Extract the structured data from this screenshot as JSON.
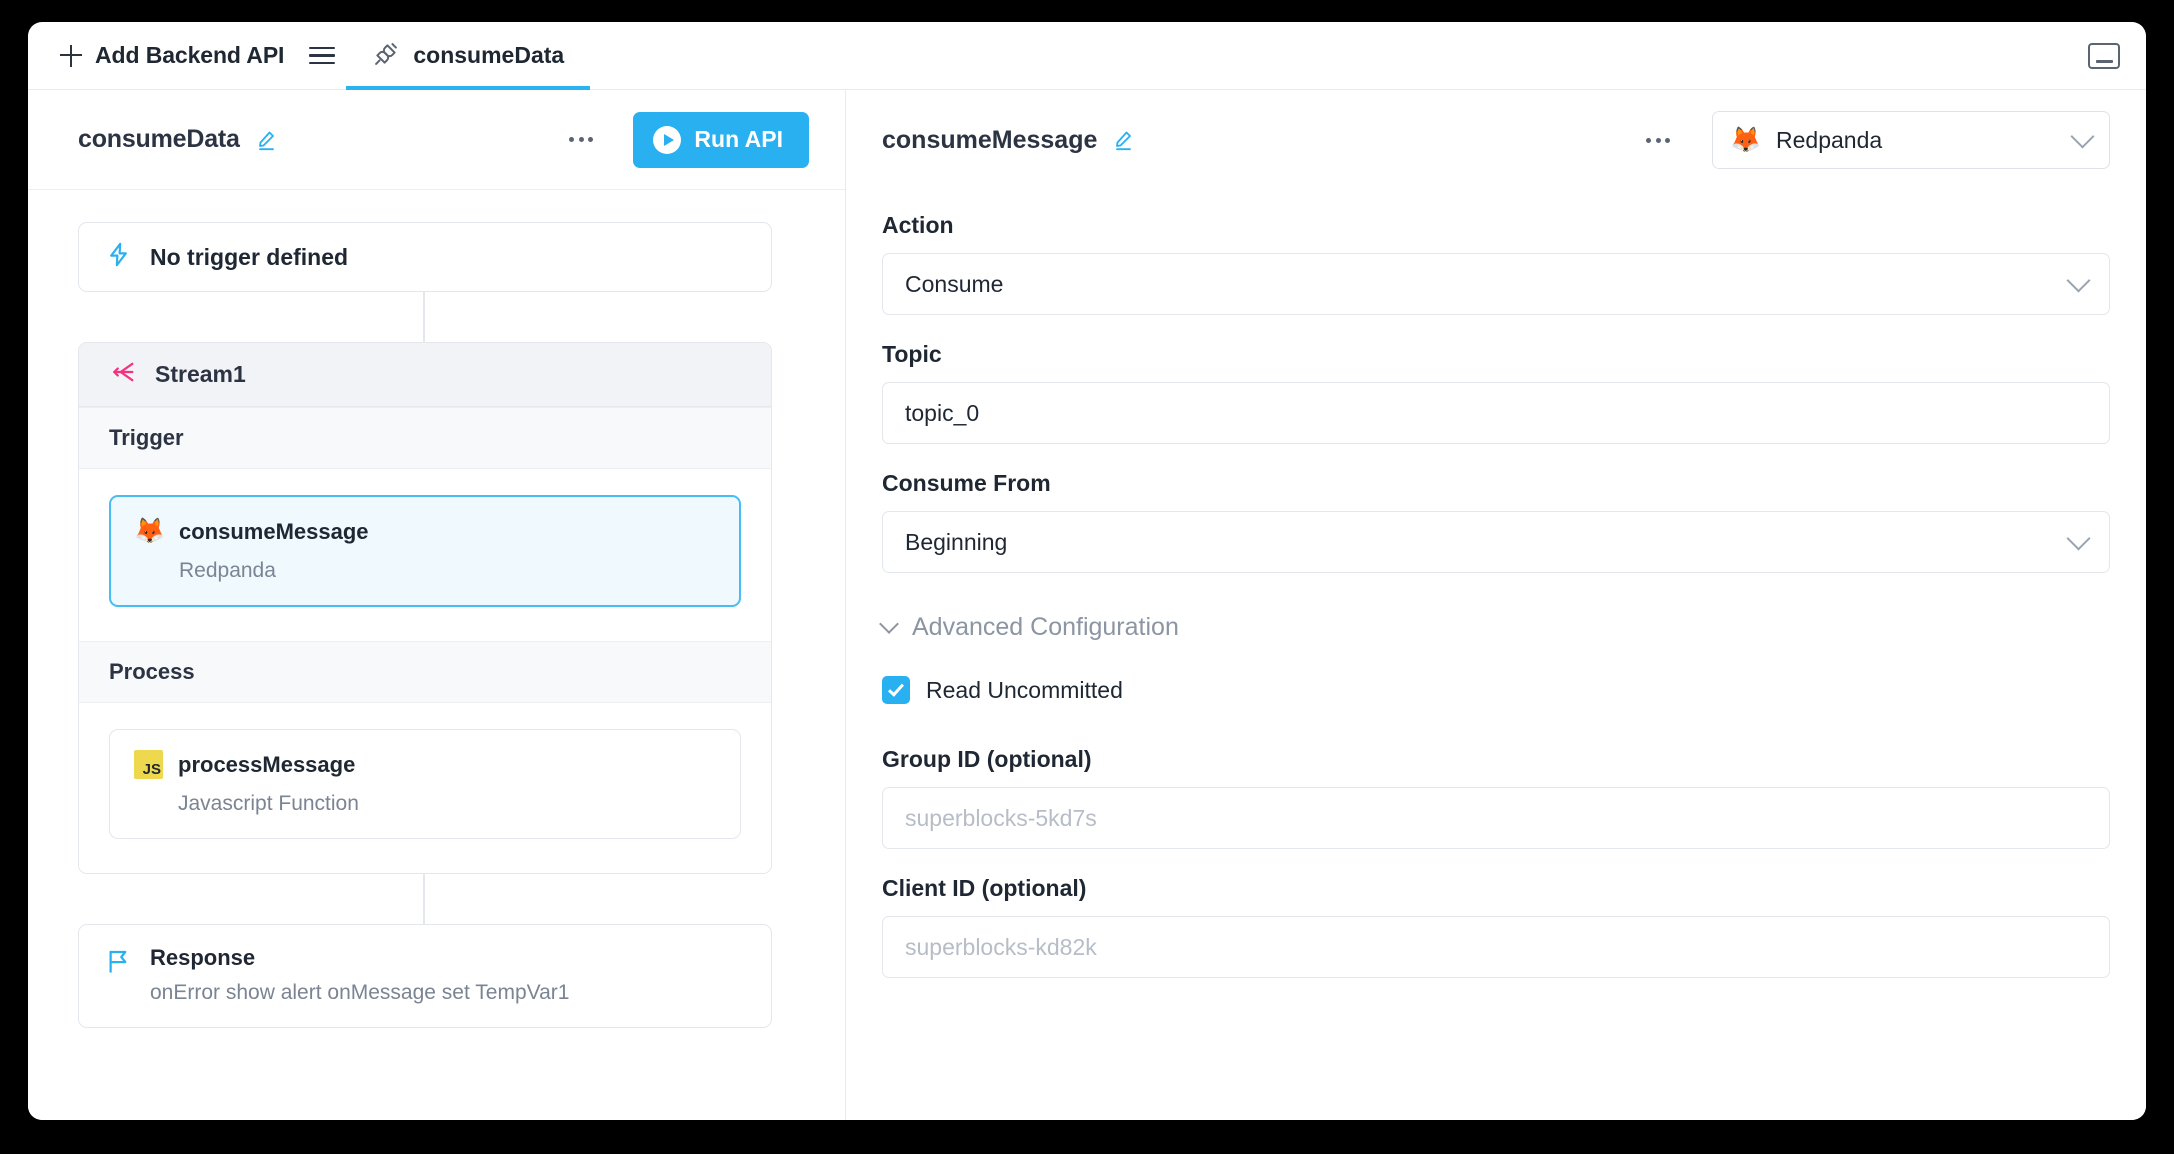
{
  "window": {
    "minimize_icon": "minimize-panel-icon"
  },
  "tabbar": {
    "add_api_label": "Add Backend API",
    "plus_icon": "plus-icon",
    "menu_icon": "hamburger-menu-icon",
    "tabs": [
      {
        "label": "consumeData",
        "icon": "plug-connector-icon",
        "active": true
      }
    ]
  },
  "left_panel": {
    "header": {
      "title": "consumeData",
      "edit_icon": "pencil-edit-icon",
      "more_icon": "more-options-icon",
      "run_button_label": "Run API",
      "run_button_icon": "play-icon",
      "run_button_color": "#29B0F1"
    },
    "trigger_block": {
      "icon": "lightning-bolt-icon",
      "label": "No trigger defined"
    },
    "stream": {
      "icon": "stream-branch-icon",
      "icon_color": "#F7307F",
      "name": "Stream1",
      "sections": [
        {
          "label": "Trigger",
          "steps": [
            {
              "icon": "redpanda-icon",
              "emoji": "🦊",
              "name": "consumeMessage",
              "subtitle": "Redpanda",
              "selected": true
            }
          ]
        },
        {
          "label": "Process",
          "steps": [
            {
              "icon": "javascript-icon",
              "badge": "JS",
              "name": "processMessage",
              "subtitle": "Javascript Function",
              "selected": false
            }
          ]
        }
      ]
    },
    "response_block": {
      "icon": "flag-icon",
      "icon_color": "#29B0F1",
      "title": "Response",
      "subtitle": "onError show alert onMessage set TempVar1"
    }
  },
  "right_panel": {
    "header": {
      "title": "consumeMessage",
      "edit_icon": "pencil-edit-icon",
      "more_icon": "more-options-icon",
      "integration": {
        "icon": "redpanda-icon",
        "emoji": "🦊",
        "name": "Redpanda",
        "chevron_icon": "chevron-down-icon"
      }
    },
    "fields": {
      "action": {
        "label": "Action",
        "value": "Consume",
        "chevron_icon": "chevron-down-icon"
      },
      "topic": {
        "label": "Topic",
        "value": "topic_0"
      },
      "consume_from": {
        "label": "Consume From",
        "value": "Beginning",
        "chevron_icon": "chevron-down-icon"
      },
      "advanced": {
        "label": "Advanced Configuration",
        "chevron_icon": "chevron-down-icon"
      },
      "read_uncommitted": {
        "label": "Read Uncommitted",
        "checked": true
      },
      "group_id": {
        "label": "Group ID (optional)",
        "placeholder": "superblocks-5kd7s",
        "value": ""
      },
      "client_id": {
        "label": "Client ID (optional)",
        "placeholder": "superblocks-kd82k",
        "value": ""
      }
    }
  }
}
